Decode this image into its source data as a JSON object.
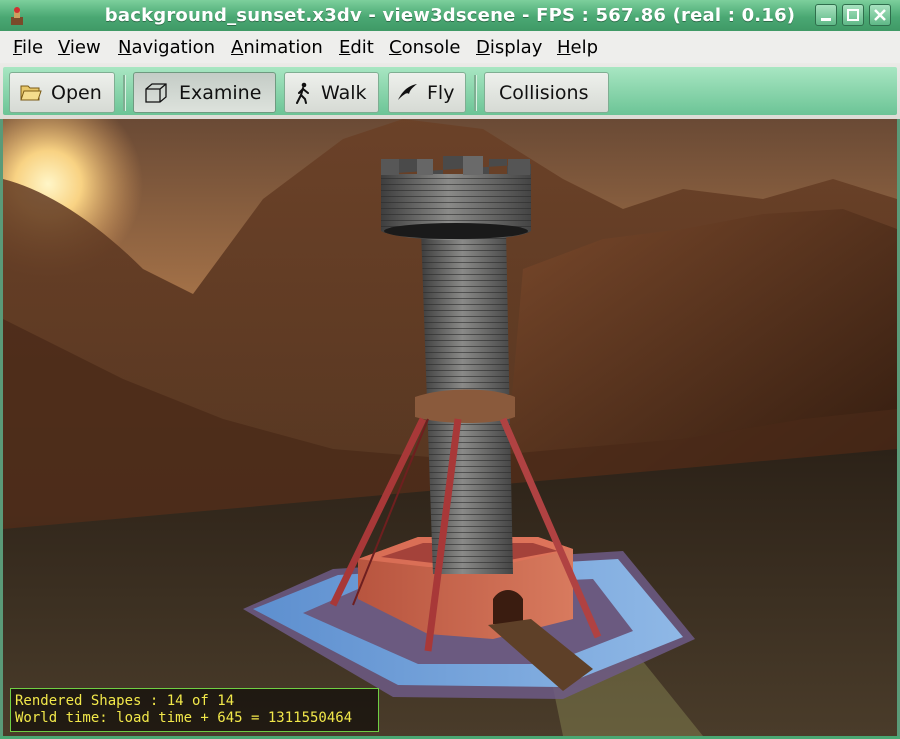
{
  "window": {
    "title": "background_sunset.x3dv - view3dscene - FPS : 567.86 (real : 0.16)"
  },
  "window_controls": [
    "minimize-icon",
    "maximize-icon",
    "close-icon"
  ],
  "menu": [
    {
      "mnemonic": "F",
      "rest": "ile"
    },
    {
      "mnemonic": "V",
      "rest": "iew"
    },
    {
      "mnemonic": "N",
      "rest": "avigation"
    },
    {
      "mnemonic": "A",
      "rest": "nimation"
    },
    {
      "mnemonic": "E",
      "rest": "dit"
    },
    {
      "mnemonic": "C",
      "rest": "onsole"
    },
    {
      "mnemonic": "D",
      "rest": "isplay"
    },
    {
      "mnemonic": "H",
      "rest": "elp"
    }
  ],
  "toolbar": {
    "open_label": "Open",
    "examine_label": "Examine",
    "walk_label": "Walk",
    "fly_label": "Fly",
    "collisions_label": "Collisions",
    "active_mode": "Examine"
  },
  "status": {
    "line1": "Rendered Shapes : 14 of 14",
    "line2": "World time: load time + 645 = 1311550464"
  },
  "colors": {
    "titlebar": "#4aa873",
    "toolbar_accent": "#8dd8ad",
    "status_text": "#f2e84a",
    "status_border": "#6fcf43"
  }
}
